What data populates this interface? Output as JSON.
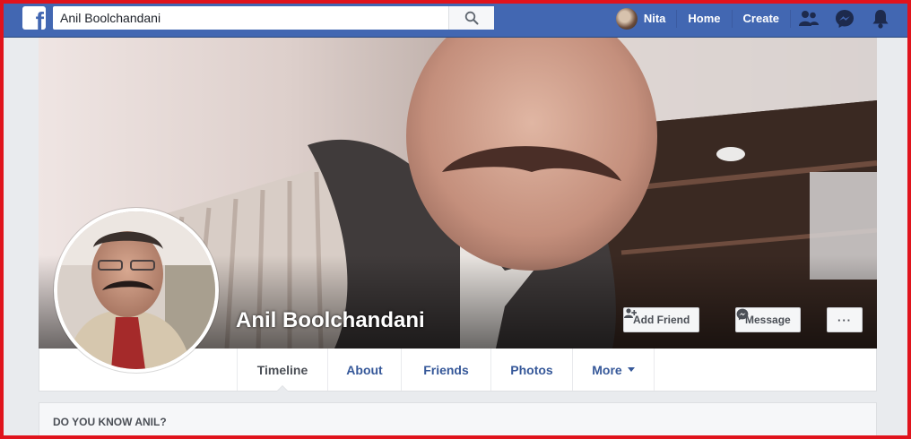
{
  "topbar": {
    "search_value": "Anil Boolchandani",
    "search_placeholder": "Search",
    "user_name": "Nita",
    "home_label": "Home",
    "create_label": "Create",
    "brand_color": "#4267b2"
  },
  "profile": {
    "name": "Anil Boolchandani",
    "add_friend_label": "Add Friend",
    "message_label": "Message",
    "more_options_label": "···"
  },
  "tabs": [
    {
      "label": "Timeline",
      "active": true
    },
    {
      "label": "About"
    },
    {
      "label": "Friends"
    },
    {
      "label": "Photos"
    },
    {
      "label": "More"
    }
  ],
  "know_panel": {
    "title": "DO YOU KNOW ANIL?"
  },
  "icons": {
    "logo": "facebook-logo-icon",
    "search": "search-icon",
    "friends": "friend-requests-icon",
    "messenger": "messenger-icon",
    "notifications": "notifications-bell-icon",
    "add_friend": "add-friend-icon",
    "message": "messenger-icon"
  }
}
